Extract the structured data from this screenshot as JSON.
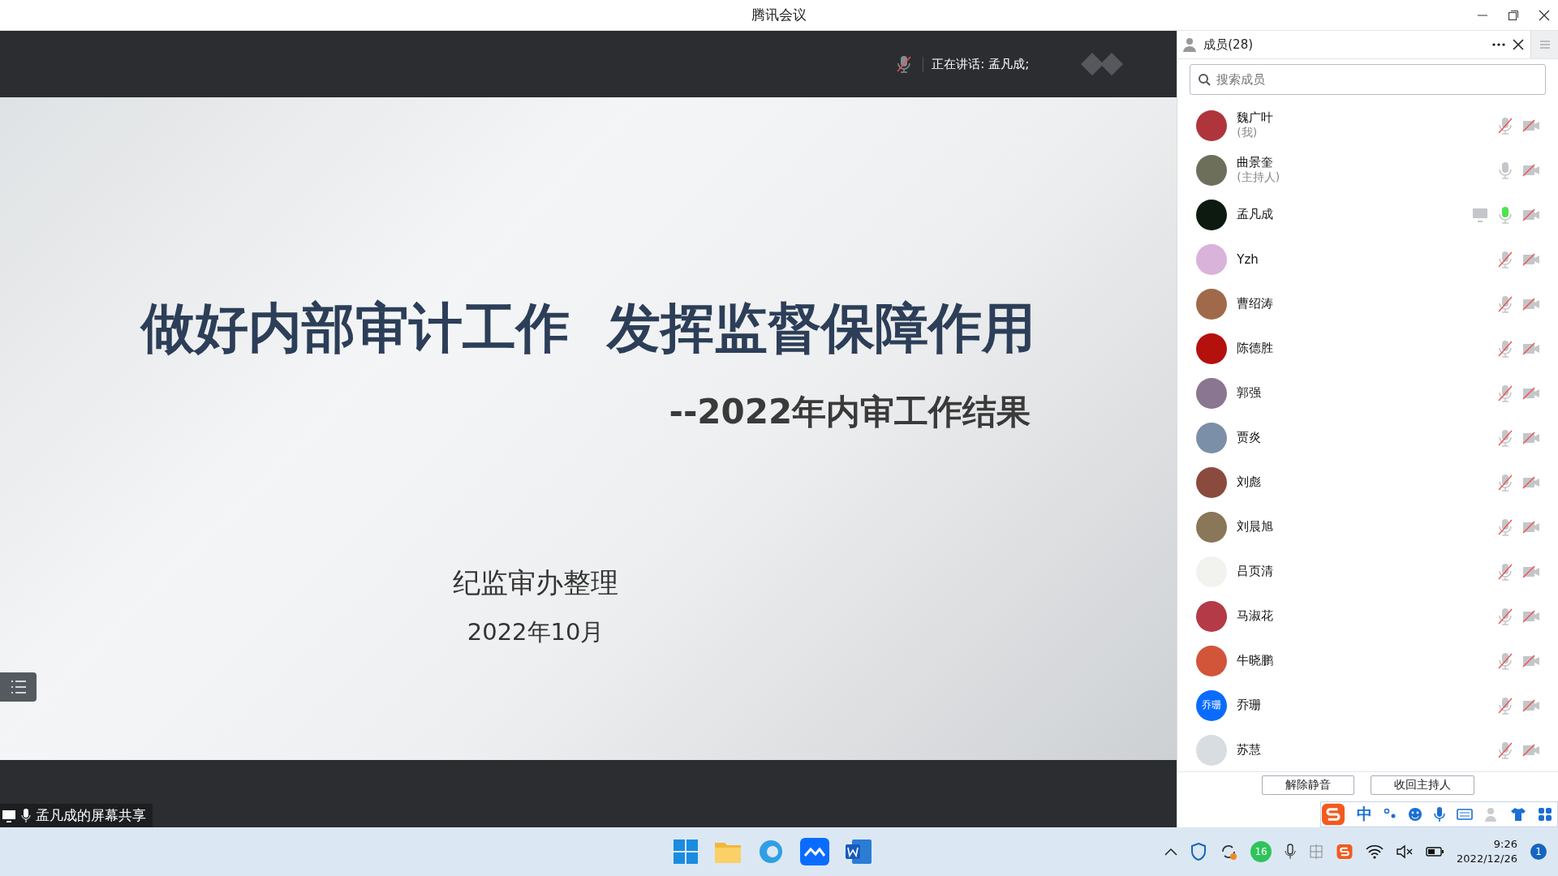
{
  "window": {
    "title": "腾讯会议"
  },
  "top_bar": {
    "mic_muted": true,
    "speaking": "正在讲话: 孟凡成;"
  },
  "slide": {
    "title": "做好内部审计工作  发挥监督保障作用",
    "subtitle": "--2022年内审工作结果",
    "author": "纪监审办整理",
    "date": "2022年10月"
  },
  "share_label": "孟凡成的屏幕共享",
  "members_panel": {
    "title": "成员(28)",
    "search": {
      "placeholder": "搜索成员"
    },
    "members": [
      {
        "name": "魏广叶",
        "role": "(我)",
        "color": "#b0343c",
        "muted": true,
        "speaking": false,
        "sharing": false
      },
      {
        "name": "曲景奎",
        "role": "(主持人)",
        "color": "#6d6f5a",
        "muted": false,
        "speaking": false,
        "sharing": false
      },
      {
        "name": "孟凡成",
        "color": "#0d1a10",
        "muted": false,
        "speaking": true,
        "sharing": true
      },
      {
        "name": "Yzh",
        "color": "#d9b3d9",
        "muted": true,
        "speaking": false,
        "sharing": false
      },
      {
        "name": "曹绍涛",
        "color": "#a06a4a",
        "muted": true,
        "speaking": false,
        "sharing": false
      },
      {
        "name": "陈德胜",
        "color": "#b4100e",
        "muted": true,
        "speaking": false,
        "sharing": false
      },
      {
        "name": "郭强",
        "color": "#8a7690",
        "muted": true,
        "speaking": false,
        "sharing": false
      },
      {
        "name": "贾炎",
        "color": "#7c8fa8",
        "muted": true,
        "speaking": false,
        "sharing": false
      },
      {
        "name": "刘彪",
        "color": "#8a4b3e",
        "muted": true,
        "speaking": false,
        "sharing": false
      },
      {
        "name": "刘晨旭",
        "color": "#8a7658",
        "muted": true,
        "speaking": false,
        "sharing": false
      },
      {
        "name": "吕页清",
        "color": "#f2f2ee",
        "muted": true,
        "speaking": false,
        "sharing": false
      },
      {
        "name": "马淑花",
        "color": "#b43a48",
        "muted": true,
        "speaking": false,
        "sharing": false
      },
      {
        "name": "牛晓鹏",
        "color": "#d2553a",
        "muted": true,
        "speaking": false,
        "sharing": false
      },
      {
        "name": "乔珊",
        "avatar_text": "乔珊",
        "color": "#0a6cff",
        "muted": true,
        "speaking": false,
        "sharing": false
      },
      {
        "name": "苏慧",
        "color": "#d8dde2",
        "muted": true,
        "speaking": false,
        "sharing": false
      }
    ],
    "buttons": [
      "解除静音",
      "收回主持人"
    ]
  },
  "ime_bar": {
    "mode": "中"
  },
  "taskbar": {
    "tray_badge": "16",
    "time": "9:26",
    "date": "2022/12/26",
    "notifications": "1"
  }
}
